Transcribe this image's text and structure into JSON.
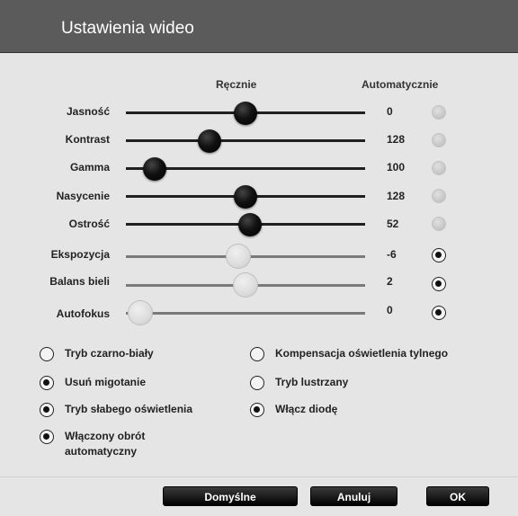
{
  "title": "Ustawienia wideo",
  "columns": {
    "manual": "Ręcznie",
    "auto": "Automatycznie"
  },
  "sliders": [
    {
      "label": "Jasność",
      "value": "0",
      "position": 0.5,
      "auto": false
    },
    {
      "label": "Kontrast",
      "value": "128",
      "position": 0.35,
      "auto": false
    },
    {
      "label": "Gamma",
      "value": "100",
      "position": 0.12,
      "auto": false
    },
    {
      "label": "Nasycenie",
      "value": "128",
      "position": 0.5,
      "auto": false
    },
    {
      "label": "Ostrość",
      "value": "52",
      "position": 0.52,
      "auto": false
    },
    {
      "label": "Ekspozycja",
      "value": "-6",
      "position": 0.47,
      "auto": true
    },
    {
      "label": "Balans bieli",
      "value": "2",
      "position": 0.5,
      "auto": true
    },
    {
      "label": "Autofokus",
      "value": "0",
      "position": 0.06,
      "auto": true
    }
  ],
  "options_left": [
    {
      "label": "Tryb czarno-biały",
      "checked": false
    },
    {
      "label": "Usuń migotanie",
      "checked": true
    },
    {
      "label": "Tryb słabego oświetlenia",
      "checked": true
    },
    {
      "label_line1": "Włączony obrót",
      "label_line2": "automatyczny",
      "checked": true
    }
  ],
  "options_right": [
    {
      "label": "Kompensacja oświetlenia tylnego",
      "checked": false
    },
    {
      "label": "Tryb lustrzany",
      "checked": false
    },
    {
      "label": "Włącz diodę",
      "checked": true
    }
  ],
  "buttons": {
    "default": "Domyślne",
    "cancel": "Anuluj",
    "ok": "OK"
  }
}
